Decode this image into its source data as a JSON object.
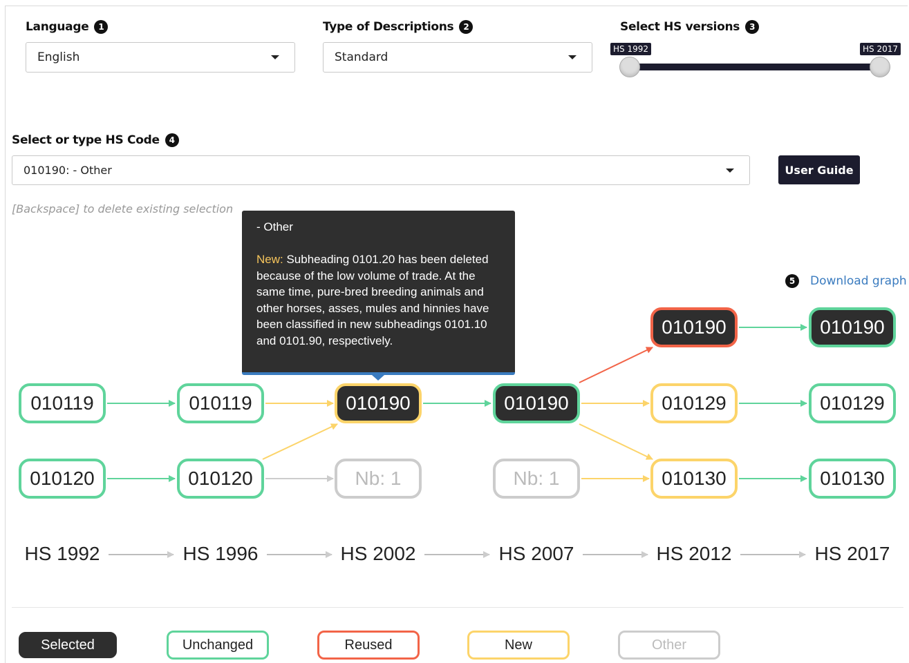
{
  "controls": {
    "language": {
      "label": "Language",
      "num": "1",
      "value": "English"
    },
    "descriptions": {
      "label": "Type of Descriptions",
      "num": "2",
      "value": "Standard"
    },
    "versions": {
      "label": "Select HS versions",
      "num": "3",
      "min_tag": "HS 1992",
      "max_tag": "HS 2017"
    },
    "hs_code": {
      "label": "Select or type HS Code",
      "num": "4",
      "value": "010190: - Other"
    },
    "user_guide": "User Guide",
    "hint": "[Backspace] to delete existing selection",
    "download": {
      "num": "5",
      "label": "Download graph"
    }
  },
  "tooltip": {
    "title": "- Other",
    "new_label": "New:",
    "text": " Subheading 0101.20 has been deleted because of the low volume of trade. At the same time, pure-bred breeding animals and other horses, asses, mules and hinnies have been classified in new subheadings 0101.10 and 0101.90, respectively."
  },
  "graph": {
    "nodes": [
      {
        "id": "n92a",
        "label": "010119",
        "status": "unchanged",
        "selected": false
      },
      {
        "id": "n92b",
        "label": "010120",
        "status": "unchanged",
        "selected": false
      },
      {
        "id": "n96a",
        "label": "010119",
        "status": "unchanged",
        "selected": false
      },
      {
        "id": "n96b",
        "label": "010120",
        "status": "unchanged",
        "selected": false
      },
      {
        "id": "n02a",
        "label": "010190",
        "status": "new",
        "selected": true
      },
      {
        "id": "n02b",
        "label": "Nb: 1",
        "status": "other",
        "selected": false
      },
      {
        "id": "n07a",
        "label": "010190",
        "status": "unchanged",
        "selected": true
      },
      {
        "id": "n07b",
        "label": "Nb: 1",
        "status": "other",
        "selected": false
      },
      {
        "id": "n12top",
        "label": "010190",
        "status": "reused",
        "selected": true
      },
      {
        "id": "n12a",
        "label": "010129",
        "status": "new",
        "selected": false
      },
      {
        "id": "n12b",
        "label": "010130",
        "status": "new",
        "selected": false
      },
      {
        "id": "n17top",
        "label": "010190",
        "status": "unchanged",
        "selected": true
      },
      {
        "id": "n17a",
        "label": "010129",
        "status": "unchanged",
        "selected": false
      },
      {
        "id": "n17b",
        "label": "010130",
        "status": "unchanged",
        "selected": false
      }
    ],
    "versions": [
      "HS 1992",
      "HS 1996",
      "HS 2002",
      "HS 2007",
      "HS 2012",
      "HS 2017"
    ]
  },
  "legend": [
    "Selected",
    "Unchanged",
    "Reused",
    "New",
    "Other"
  ],
  "colors": {
    "unchanged": "#5fd49b",
    "new": "#fcd46a",
    "reused": "#f26448",
    "other": "#cccccc",
    "selected": "#2e2e2e",
    "dark_ui": "#1c1c2e",
    "link": "#3a7bbf"
  }
}
